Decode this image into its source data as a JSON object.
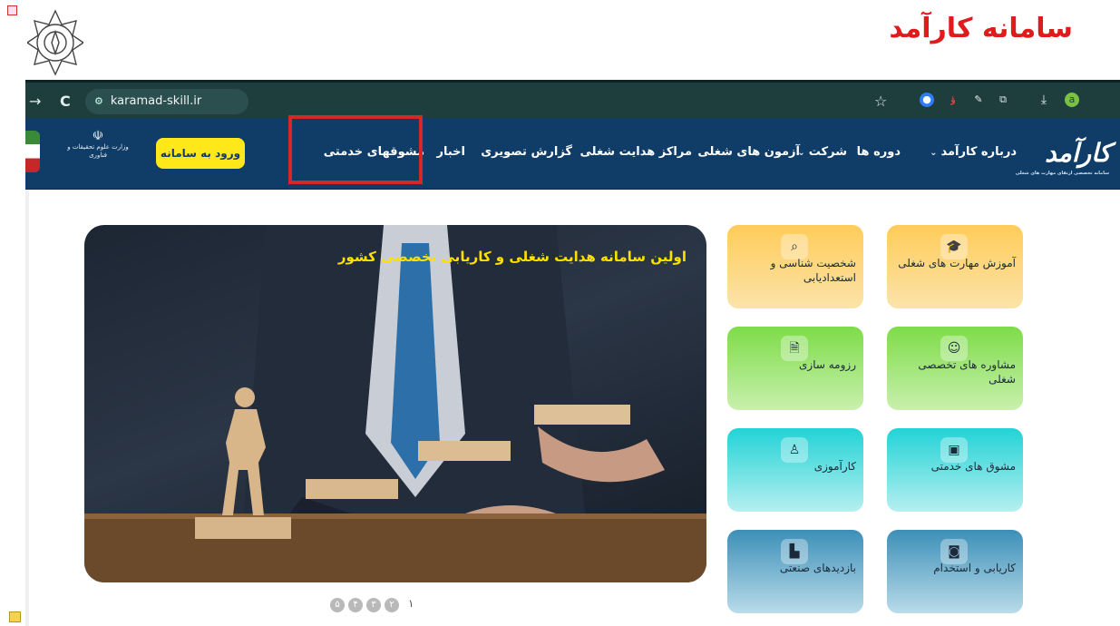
{
  "slide_title": "سامانه کارآمد",
  "browser": {
    "url": "karamad-skill.ir",
    "icons": [
      "forward-arrow-icon",
      "reload-icon",
      "site-settings-icon",
      "star-icon",
      "extension-icons",
      "download-icon",
      "profile-avatar-icon"
    ],
    "profile_initial": "a"
  },
  "site": {
    "logo_text": "کارآمد",
    "logo_tagline": "سامانه تخصصی ارتقای مهارت های شغلی",
    "menu": [
      {
        "label": "درباره کارآمد",
        "has_dropdown": true
      },
      {
        "label": "دوره ها",
        "has_dropdown": false
      },
      {
        "label": "شرکت",
        "has_dropdown": true
      },
      {
        "label": "آزمون های شغلی",
        "has_dropdown": false
      },
      {
        "label": "مراکز هدایت شغلی",
        "has_dropdown": false
      },
      {
        "label": "گزارش تصویری",
        "has_dropdown": false
      },
      {
        "label": "اخبار",
        "has_dropdown": false
      },
      {
        "label": "مشوقهای خدمتی",
        "has_dropdown": false
      }
    ],
    "login_button": "ورود به سامانه",
    "ministry_text": "وزارت علوم تحقیقات و فناوری",
    "highlight_color": "#d6252b",
    "nav_color": "#0f3d67",
    "accent_yellow": "#ffe81a"
  },
  "hero": {
    "title": "اولین سامانه هدایت شغلی و کاریابی تخصصی کشور",
    "pagination": [
      "۱",
      "۲",
      "۳",
      "۴",
      "۵"
    ]
  },
  "tiles": [
    {
      "label": "آموزش مهارت های شغلی",
      "icon": "graduation-cap-icon",
      "color": "orange"
    },
    {
      "label": "شخصیت شناسی و استعدادیابی",
      "icon": "search-icon",
      "color": "orange"
    },
    {
      "label": "مشاوره های تخصصی شغلی",
      "icon": "counselor-icon",
      "color": "green"
    },
    {
      "label": "رزومه سازی",
      "icon": "document-icon",
      "color": "green"
    },
    {
      "label": "مشوق های خدمتی",
      "icon": "presentation-icon",
      "color": "teal"
    },
    {
      "label": "کارآموزی",
      "icon": "trainee-icon",
      "color": "teal"
    },
    {
      "label": "کاریابی و استخدام",
      "icon": "job-search-icon",
      "color": "blue"
    },
    {
      "label": "بازدیدهای صنعتی",
      "icon": "factory-icon",
      "color": "blue"
    }
  ]
}
